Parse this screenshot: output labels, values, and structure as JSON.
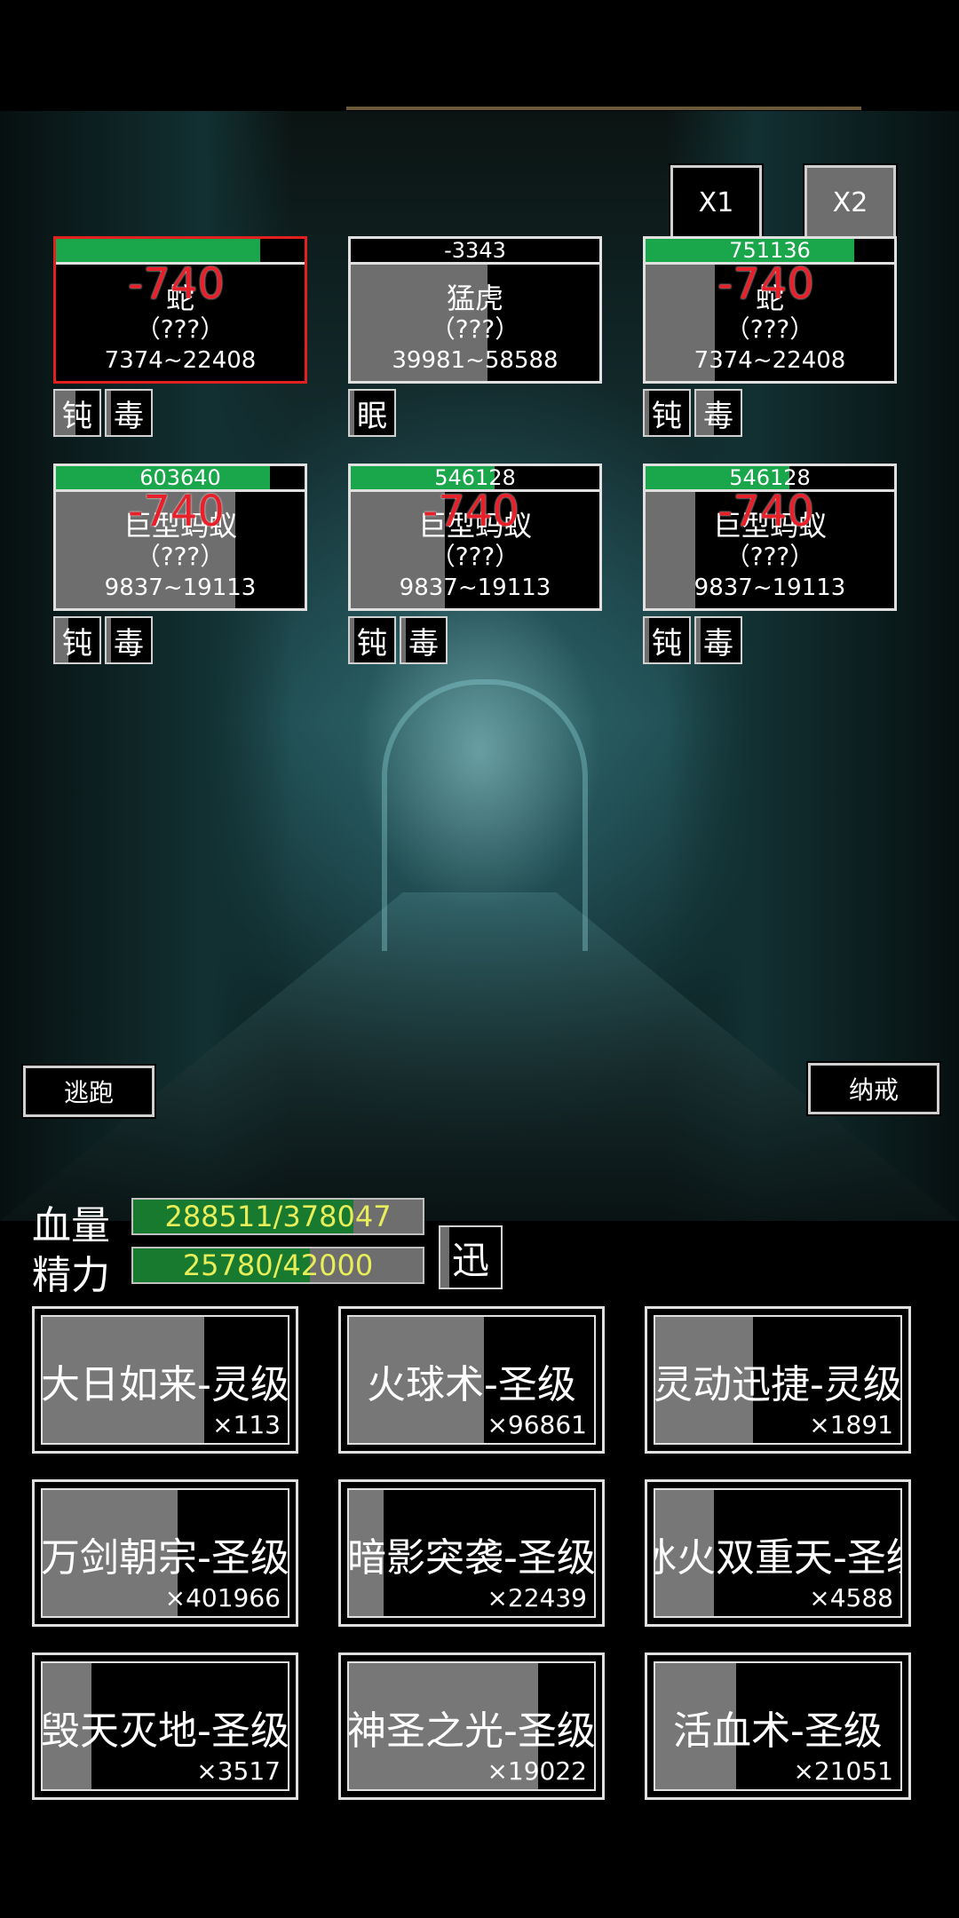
{
  "speed_buttons": {
    "x1": "X1",
    "x2": "X2"
  },
  "enemies": [
    {
      "hp": "",
      "hp_fill": 0.82,
      "shade": 0.0,
      "name": "蛇",
      "level": "（???）",
      "attack": "7374~22408",
      "selected": true,
      "damage": "-740",
      "tags": [
        {
          "label": "钝",
          "fill": 0.45
        },
        {
          "label": "毒",
          "fill": 0.1
        }
      ]
    },
    {
      "hp": "-3343",
      "hp_fill": 0.0,
      "shade": 0.55,
      "name": "猛虎",
      "level": "（???）",
      "attack": "39981~58588",
      "selected": false,
      "damage": "",
      "tags": [
        {
          "label": "眠",
          "fill": 0.1
        }
      ]
    },
    {
      "hp": "751136",
      "hp_fill": 0.84,
      "shade": 0.28,
      "name": "蛇",
      "level": "（???）",
      "attack": "7374~22408",
      "selected": false,
      "damage": "-740",
      "tags": [
        {
          "label": "钝",
          "fill": 0.1
        },
        {
          "label": "毒",
          "fill": 0.4
        }
      ]
    },
    {
      "hp": "603640",
      "hp_fill": 0.86,
      "shade": 0.72,
      "name": "巨型蚂蚁",
      "level": "（???）",
      "attack": "9837~19113",
      "selected": false,
      "damage": "-740",
      "tags": [
        {
          "label": "钝",
          "fill": 0.3
        },
        {
          "label": "毒",
          "fill": 0.1
        }
      ]
    },
    {
      "hp": "546128",
      "hp_fill": 0.58,
      "shade": 0.38,
      "name": "巨型蚂蚁",
      "level": "（???）",
      "attack": "9837~19113",
      "selected": false,
      "damage": "-740",
      "tags": [
        {
          "label": "钝",
          "fill": 0.1
        },
        {
          "label": "毒",
          "fill": 0.1
        }
      ]
    },
    {
      "hp": "546128",
      "hp_fill": 0.58,
      "shade": 0.2,
      "name": "巨型蚂蚁",
      "level": "（???）",
      "attack": "9837~19113",
      "selected": false,
      "damage": "-740",
      "tags": [
        {
          "label": "钝",
          "fill": 0.1
        },
        {
          "label": "毒",
          "fill": 0.1
        }
      ]
    }
  ],
  "buttons": {
    "flee": "逃跑",
    "ring": "纳戒"
  },
  "stats": {
    "hp_label": "血量",
    "hp_text": "288511/378047",
    "hp_fill": 0.76,
    "energy_label": "精力",
    "energy_text": "25780/42000",
    "energy_fill": 0.61,
    "speed_tag": "迅"
  },
  "skills": [
    {
      "name": "大日如来-灵级",
      "count": "×113",
      "fill": 0.66
    },
    {
      "name": "火球术-圣级",
      "count": "×96861",
      "fill": 0.55
    },
    {
      "name": "灵动迅捷-灵级",
      "count": "×1891",
      "fill": 0.4
    },
    {
      "name": "万剑朝宗-圣级",
      "count": "×401966",
      "fill": 0.55
    },
    {
      "name": "暗影突袭-圣级",
      "count": "×22439",
      "fill": 0.14
    },
    {
      "name": "冰火双重天-圣级",
      "count": "×4588",
      "fill": 0.24
    },
    {
      "name": "毁天灭地-圣级",
      "count": "×3517",
      "fill": 0.2
    },
    {
      "name": "神圣之光-圣级",
      "count": "×19022",
      "fill": 0.77
    },
    {
      "name": "活血术-圣级",
      "count": "×21051",
      "fill": 0.33
    }
  ]
}
